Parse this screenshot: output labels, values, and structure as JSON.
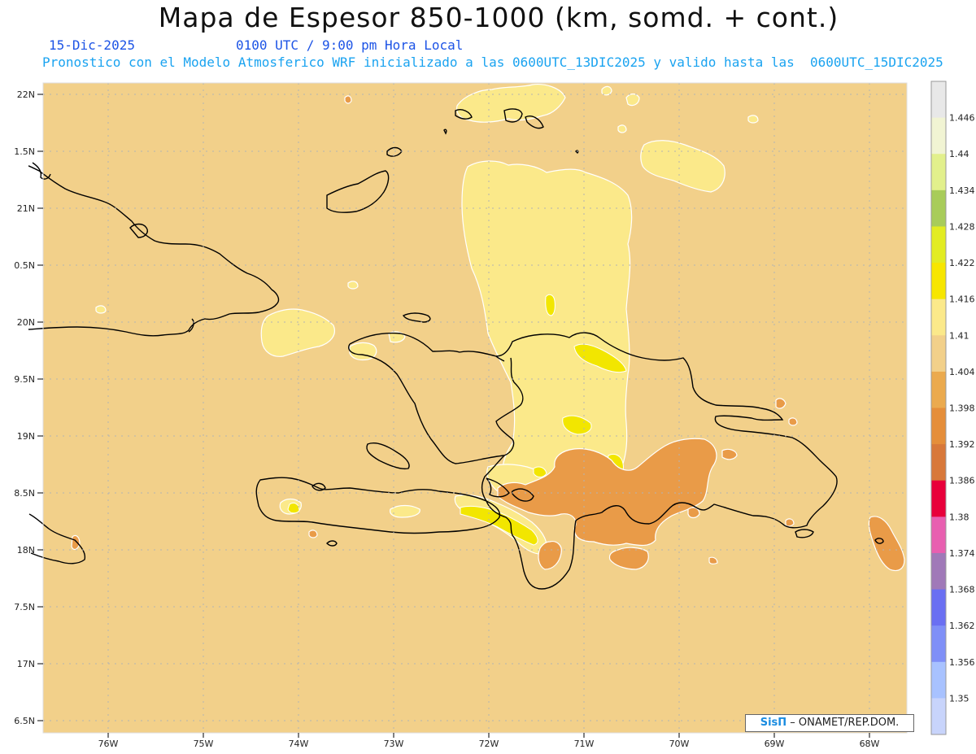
{
  "header": {
    "title": "Mapa de Espesor 850-1000 (km, somd. + cont.)",
    "date": "15-Dic-2025",
    "time": "0100 UTC / 9:00 pm Hora Local",
    "info": "Pronostico con el Modelo Atmosferico WRF inicializado a las 0600UTC_13DIC2025 y valido hasta las  0600UTC_15DIC2025"
  },
  "map": {
    "lat_labels": [
      "22N",
      "1.5N",
      "21N",
      "0.5N",
      "20N",
      "9.5N",
      "19N",
      "8.5N",
      "18N",
      "7.5N",
      "17N",
      "6.5N"
    ],
    "lon_labels": [
      "76W",
      "75W",
      "74W",
      "73W",
      "72W",
      "71W",
      "70W",
      "69W",
      "68W"
    ],
    "region": "Hispaniola / Bahamas",
    "background_color": "#f2d08a"
  },
  "colorbar": {
    "labels": [
      "1.446",
      "1.44",
      "1.434",
      "1.428",
      "1.422",
      "1.416",
      "1.41",
      "1.404",
      "1.398",
      "1.392",
      "1.386",
      "1.38",
      "1.374",
      "1.368",
      "1.362",
      "1.356",
      "1.35"
    ],
    "colors": [
      "#e8e8e8",
      "#f1f4d3",
      "#e2f08c",
      "#a8cc5a",
      "#e2ec22",
      "#f7e600",
      "#fbe98a",
      "#f2d08a",
      "#ebaa4e",
      "#e58e3a",
      "#d8783a",
      "#e8003a",
      "#e85fb0",
      "#a079b8",
      "#6a6ff2",
      "#7f8ff7",
      "#a8c2ff",
      "#c8d4fb"
    ]
  },
  "credit": {
    "logo": "SisΠ",
    "text": " – ONAMET/REP.DOM."
  }
}
